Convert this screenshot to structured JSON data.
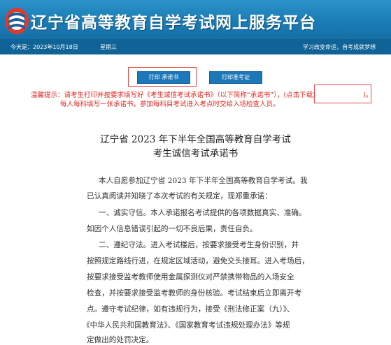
{
  "header": {
    "title": "辽宁省高等教育自学考试网上服务平台",
    "logo_icon": "exam-logo-icon"
  },
  "infobar": {
    "date": "今天是：2023年10月18日",
    "weekday": "星期三",
    "slogan": "学习改变命运，自考成就梦想"
  },
  "buttons": {
    "print_pledge": "打印 承诺书",
    "print_admission": "打印准考证"
  },
  "notice": {
    "line1": "温馨提示：请考生打印并按要求填写好《考生诚信考试承诺书》（以下简称“承诺书”），",
    "download_link": "(点击下载)",
    "line1_end": ")。",
    "line2": "每人每科填写一张承诺书，参加每科目考试进入考点时交给入场检查人员。"
  },
  "document": {
    "title_line1": "辽宁省 2023 年下半年全国高等教育自学考试",
    "title_line2": "考生诚信考试承诺书",
    "lines": [
      "本人自愿参加辽宁省 2023 年下半年全国高等教育自学考试。我",
      "已认真阅读并知晓了本次考试的有关规定，现郑重承诺：",
      "一、诚实守信。本人承诺报名考试提供的各项数据真实、准确。",
      "如因个人信息错误引起的一切不良后果，责任自负。",
      "二、遵纪守法。进入考试楼后，按要求接受考生身份识别，并",
      "按照规定路线行进，在规定区域活动，避免交头接耳。进入考场后，",
      "按要求接受监考教师使用金属探测仪对严禁携带物品的入场安全",
      "检查，并按要求接受监考教师的身份核验。考试结束后立即离开考",
      "点。遵守考试纪律，如有违规行为，接受《刑法修正案（九）》、",
      "《中华人民共和国教育法》、《国家教育考试违规处理办法》等规",
      "定做出的处罚决定。"
    ]
  },
  "colors": {
    "header_blue": "#1a7cb6",
    "infobar_blue": "#0f6397",
    "button_blue": "#1d78ba",
    "notice_red": "#e8261f",
    "highlight_red": "#e24a4a"
  }
}
